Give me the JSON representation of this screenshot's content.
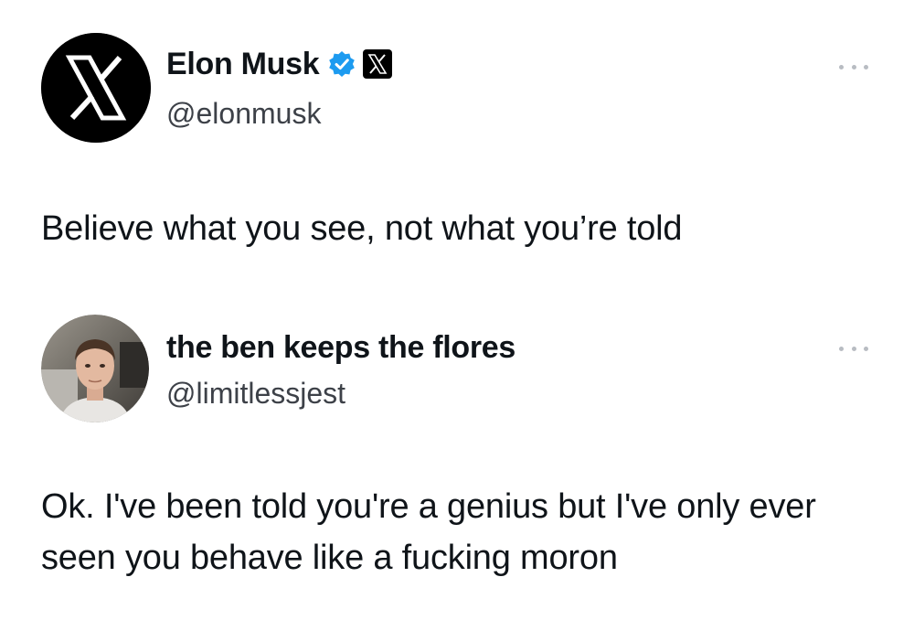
{
  "tweets": [
    {
      "display_name": "Elon Musk",
      "handle": "@elonmusk",
      "avatar_icon": "x-logo-icon",
      "verified_icon": "verified-badge-icon",
      "affiliation_icon": "x-logo-icon",
      "more_icon": "more-options-icon",
      "text": "Believe what you see, not what you’re told"
    },
    {
      "display_name": "the ben keeps the flores",
      "handle": "@limitlessjest",
      "avatar_icon": "profile-photo",
      "more_icon": "more-options-icon",
      "text": "Ok. I've been told you're a genius but I've only ever seen you behave like a fucking moron"
    }
  ],
  "colors": {
    "text": "#0f1419",
    "handle": "#3d4148",
    "verified_blue": "#1d9bf0",
    "dots": "#b8bcc2"
  }
}
